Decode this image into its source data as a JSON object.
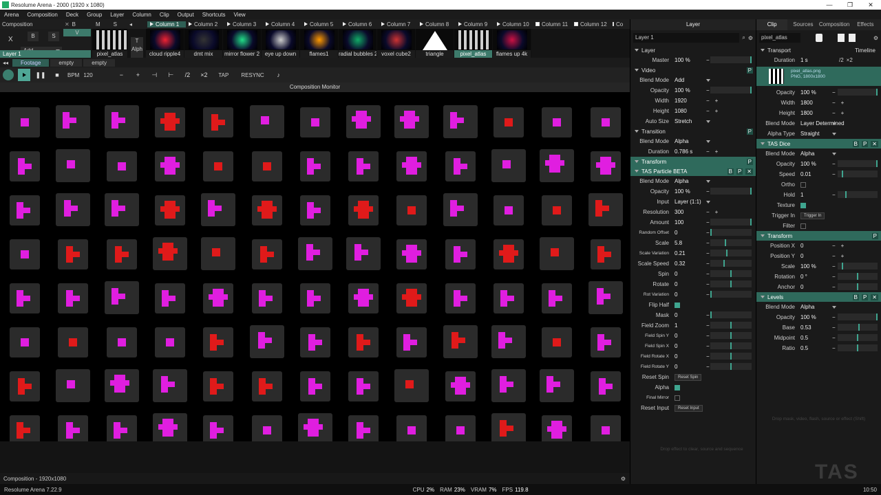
{
  "window": {
    "title": "Resolume Arena - 2000 (1920 x 1080)"
  },
  "menu": [
    "Arena",
    "Composition",
    "Deck",
    "Group",
    "Layer",
    "Column",
    "Clip",
    "Output",
    "Shortcuts",
    "View"
  ],
  "composition_label": "Composition",
  "layer_controls": {
    "b": "B",
    "s": "S",
    "m": "M",
    "x": "X",
    "add": "Add",
    "v": "V",
    "t": "T",
    "alph": "Alph",
    "layer_name": "Layer 1"
  },
  "columns": [
    "Column 1",
    "Column 2",
    "Column 3",
    "Column 4",
    "Column 5",
    "Column 6",
    "Column 7",
    "Column 8",
    "Column 9",
    "Column 10",
    "Column 11",
    "Column 12",
    "Co"
  ],
  "clips": [
    "pixel_atlas",
    "cloud ripple4",
    "dmt mix",
    "mirror flower 2",
    "eye up down",
    "flames1",
    "radial bubbles 2",
    "voxel cube2",
    "triangle",
    "pixel_atlas",
    "flames up 4k"
  ],
  "decks": [
    "Footage",
    "empty",
    "empty"
  ],
  "transport": {
    "bpm_label": "BPM",
    "bpm": "120",
    "tap": "TAP",
    "resync": "RESYNC",
    "half": "/2",
    "double": "×2"
  },
  "monitor": {
    "title": "Composition Monitor",
    "footer": "Composition - 1920x1080"
  },
  "layer_panel": {
    "header": "Layer",
    "name_value": "Layer 1",
    "sections": {
      "layer": {
        "title": "Layer",
        "rows": [
          {
            "k": "Master",
            "v": "100 %",
            "bar": 1.0
          }
        ]
      },
      "video": {
        "title": "Video",
        "rows": [
          {
            "k": "Blend Mode",
            "v": "Add"
          },
          {
            "k": "Opacity",
            "v": "100 %",
            "bar": 1.0
          },
          {
            "k": "Width",
            "v": "1920"
          },
          {
            "k": "Height",
            "v": "1080"
          },
          {
            "k": "Auto Size",
            "v": "Stretch"
          }
        ]
      },
      "transition": {
        "title": "Transition",
        "rows": [
          {
            "k": "Blend Mode",
            "v": "Alpha"
          },
          {
            "k": "Duration",
            "v": "0.786 s"
          }
        ]
      },
      "transform": {
        "title": "Transform"
      },
      "particle": {
        "title": "TAS Particle BETA",
        "rows": [
          {
            "k": "Blend Mode",
            "v": "Alpha"
          },
          {
            "k": "Opacity",
            "v": "100 %",
            "bar": 1.0
          },
          {
            "k": "Input",
            "v": "Layer (1:1)"
          },
          {
            "k": "Resolution",
            "v": "300"
          },
          {
            "k": "Amount",
            "v": "100",
            "bar": 1.0
          },
          {
            "k": "Random Offset",
            "v": "0",
            "bar": 0.0
          },
          {
            "k": "Scale",
            "v": "5.8",
            "bar": 0.36
          },
          {
            "k": "Scale Variation",
            "v": "0.21",
            "bar": 0.4
          },
          {
            "k": "Scale Speed",
            "v": "0.32",
            "bar": 0.32
          },
          {
            "k": "Spin",
            "v": "0",
            "bar": 0.5
          },
          {
            "k": "Rotate",
            "v": "0",
            "bar": 0.5
          },
          {
            "k": "Rot Variation",
            "v": "0",
            "bar": 0.0
          },
          {
            "k": "Flip Half",
            "check": true
          },
          {
            "k": "Mask",
            "v": "0",
            "bar": 0.0
          },
          {
            "k": "Field Zoom",
            "v": "1",
            "bar": 0.5
          },
          {
            "k": "Field Spin Y",
            "v": "0",
            "bar": 0.5
          },
          {
            "k": "Field Spin X",
            "v": "0",
            "bar": 0.5
          },
          {
            "k": "Field Rotate X",
            "v": "0",
            "bar": 0.5
          },
          {
            "k": "Field Rotate Y",
            "v": "0",
            "bar": 0.5
          },
          {
            "k": "Reset Spin",
            "button": "Reset Spin"
          },
          {
            "k": "Alpha",
            "check": true
          },
          {
            "k": "Final Mirror",
            "check": false
          },
          {
            "k": "Reset Input",
            "button": "Reset Input"
          }
        ]
      }
    }
  },
  "clip_panel": {
    "tabs": [
      "Clip",
      "Sources",
      "Composition",
      "Effects"
    ],
    "name_value": "pixel_atlas",
    "transport": {
      "title": "Transport",
      "mode": "Timeline",
      "duration_label": "Duration",
      "duration": "1 s",
      "half": "/2",
      "double": "×2"
    },
    "source": {
      "file": "pixel_atlas.png",
      "info": "PNG, 1800x1800"
    },
    "rows_top": [
      {
        "k": "Opacity",
        "v": "100 %",
        "bar": 1.0
      },
      {
        "k": "Width",
        "v": "1800"
      },
      {
        "k": "Height",
        "v": "1800"
      },
      {
        "k": "Blend Mode",
        "v": "Layer Determined"
      },
      {
        "k": "Alpha Type",
        "v": "Straight"
      }
    ],
    "dice": {
      "title": "TAS Dice",
      "rows": [
        {
          "k": "Blend Mode",
          "v": "Alpha"
        },
        {
          "k": "Opacity",
          "v": "100 %",
          "bar": 1.0
        },
        {
          "k": "Speed",
          "v": "0.01",
          "bar": 0.1
        },
        {
          "k": "Ortho",
          "check": false
        },
        {
          "k": "Hold",
          "v": "1",
          "bar": 0.2
        },
        {
          "k": "Texture",
          "check": true
        },
        {
          "k": "Trigger In",
          "button": "Trigger In"
        },
        {
          "k": "Filter",
          "check": false
        }
      ]
    },
    "transform": {
      "title": "Transform",
      "rows": [
        {
          "k": "Position X",
          "v": "0"
        },
        {
          "k": "Position Y",
          "v": "0"
        },
        {
          "k": "Scale",
          "v": "100 %",
          "bar": 0.1
        },
        {
          "k": "Rotation",
          "v": "0 °",
          "bar": 0.5
        },
        {
          "k": "Anchor",
          "v": "0",
          "bar": 0.5
        }
      ]
    },
    "levels": {
      "title": "Levels",
      "rows": [
        {
          "k": "Blend Mode",
          "v": "Alpha"
        },
        {
          "k": "Opacity",
          "v": "100 %",
          "bar": 1.0
        },
        {
          "k": "Base",
          "v": "0.53",
          "bar": 0.53
        },
        {
          "k": "Midpoint",
          "v": "0.5",
          "bar": 0.5
        },
        {
          "k": "Ratio",
          "v": "0.5",
          "bar": 0.5
        }
      ]
    },
    "drop_hint": "Drop mask, video, flash, source or effect (Shift)",
    "drop_hint2": "Drop effect to clear, source and sequence"
  },
  "logo": "TAS",
  "status": {
    "version": "Resolume Arena 7.22.9",
    "cpu_label": "CPU",
    "cpu": "2%",
    "ram_label": "RAM",
    "ram": "23%",
    "vram_label": "VRAM",
    "vram": "7%",
    "fps_label": "FPS",
    "fps": "119.8",
    "time": "10:50"
  },
  "colors": {
    "accent": "#3fa58f",
    "section": "#2f6a5c",
    "magenta": "#e01ee0",
    "red": "#e01a1a"
  }
}
